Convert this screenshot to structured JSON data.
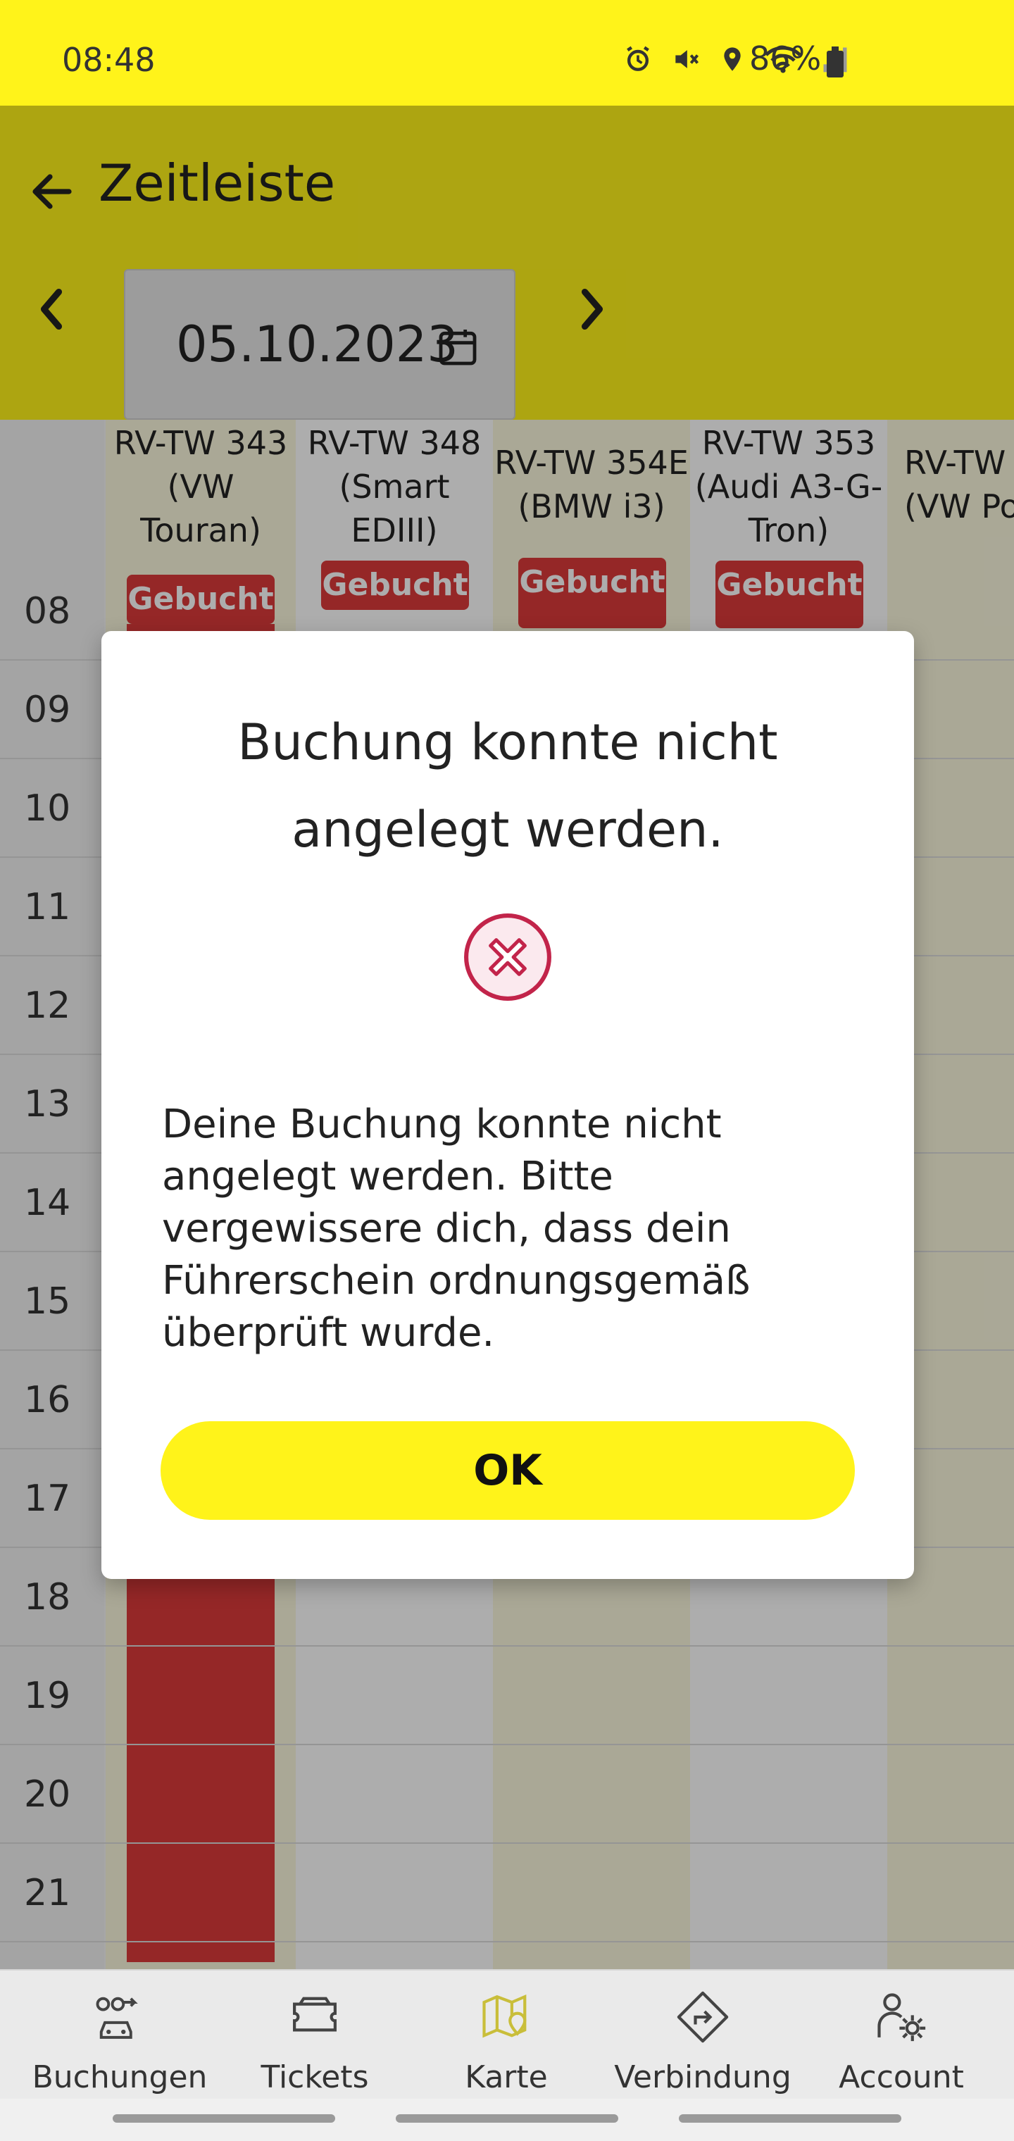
{
  "status": {
    "time": "08:48",
    "battery": "86%",
    "icons": [
      "alarm-icon",
      "mute-icon",
      "location-icon",
      "wifi-icon",
      "signal-icon",
      "battery-icon"
    ]
  },
  "header": {
    "title": "Zeitleiste",
    "date": "05.10.2023"
  },
  "timeline": {
    "hours": [
      "08",
      "09",
      "10",
      "11",
      "12",
      "13",
      "14",
      "15",
      "16",
      "17",
      "18",
      "19",
      "20",
      "21"
    ],
    "vehicles": [
      {
        "line1": "RV-TW 343",
        "line2": "(VW",
        "line3": "Touran)",
        "status": "Gebucht"
      },
      {
        "line1": "RV-TW 348",
        "line2": "(Smart",
        "line3": "EDIII)",
        "status": "Gebucht"
      },
      {
        "line1": "RV-TW 354E",
        "line2": "(BMW i3)",
        "line3": "",
        "status": "Gebucht"
      },
      {
        "line1": "RV-TW 353",
        "line2": "(Audi A3-G-",
        "line3": "Tron)",
        "status": "Gebucht"
      },
      {
        "line1": "RV-TW",
        "line2": "(VW Po",
        "line3": "",
        "status": ""
      }
    ]
  },
  "dialog": {
    "title": "Buchung konnte nicht angelegt werden.",
    "message": "Deine Buchung konnte nicht angelegt werden. Bitte vergewissere dich, dass dein Führerschein ordnungsgemäß überprüft wurde.",
    "ok_label": "OK"
  },
  "bottom_nav": {
    "items": [
      {
        "label": "Buchungen",
        "icon": "bookings-icon"
      },
      {
        "label": "Tickets",
        "icon": "ticket-icon"
      },
      {
        "label": "Karte",
        "icon": "map-icon"
      },
      {
        "label": "Verbindung",
        "icon": "directions-icon"
      },
      {
        "label": "Account",
        "icon": "account-settings-icon"
      }
    ],
    "active_index": 2
  },
  "colors": {
    "brand_yellow": "#fff31a",
    "booked_red": "#dc3a3a",
    "error_red": "#c2244a"
  }
}
